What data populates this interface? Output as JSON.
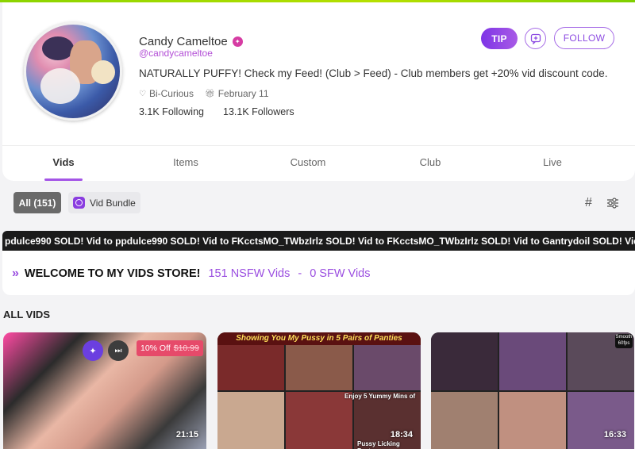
{
  "profile": {
    "name": "Candy Cameltoe",
    "handle": "@candycameltoe",
    "bio": "NATURALLY PUFFY! Check my Feed! (Club > Feed) - Club members get +20% vid discount code.",
    "orientation": "Bi-Curious",
    "birthday": "February 11",
    "following": "3.1K Following",
    "followers": "13.1K Followers",
    "verified_color": "#d63ca3"
  },
  "actions": {
    "tip_label": "TIP",
    "message_icon": "chat-plus-icon",
    "follow_label": "FOLLOW"
  },
  "tabs": [
    {
      "label": "Vids",
      "active": true
    },
    {
      "label": "Items",
      "active": false
    },
    {
      "label": "Custom",
      "active": false
    },
    {
      "label": "Club",
      "active": false
    },
    {
      "label": "Live",
      "active": false
    }
  ],
  "filters": {
    "all_label": "All (151)",
    "bundle_label": "Vid Bundle"
  },
  "ticker": {
    "text": "pdulce990   SOLD! Vid to ppdulce990   SOLD! Vid to FKcctsMO_TWbzIrlz   SOLD! Vid to FKcctsMO_TWbzIrlz   SOLD! Vid to Gantrydoil   SOLD! Vid to"
  },
  "welcome": {
    "title": "WELCOME TO MY VIDS STORE!",
    "nsfw": "151 NSFW Vids",
    "separator": "-",
    "sfw": "0 SFW Vids"
  },
  "section_title": "ALL VIDS",
  "videos": [
    {
      "duration": "21:15",
      "discount": "10% Off",
      "old_price": "$10.99"
    },
    {
      "duration": "18:34",
      "title_overlay": "Showing You My Pussy in 5 Pairs of Panties",
      "caption": "Enjoy 5 Yummy Mins of",
      "caption2": "Pussy Licking Fantasy"
    },
    {
      "duration": "16:33",
      "badge": "Smooth 60fps"
    }
  ],
  "colors": {
    "accent": "#9b4fe0",
    "tip_gradient_start": "#7e35e6",
    "discount_bg": "#e64a6a",
    "topbar": "#8bd400"
  }
}
